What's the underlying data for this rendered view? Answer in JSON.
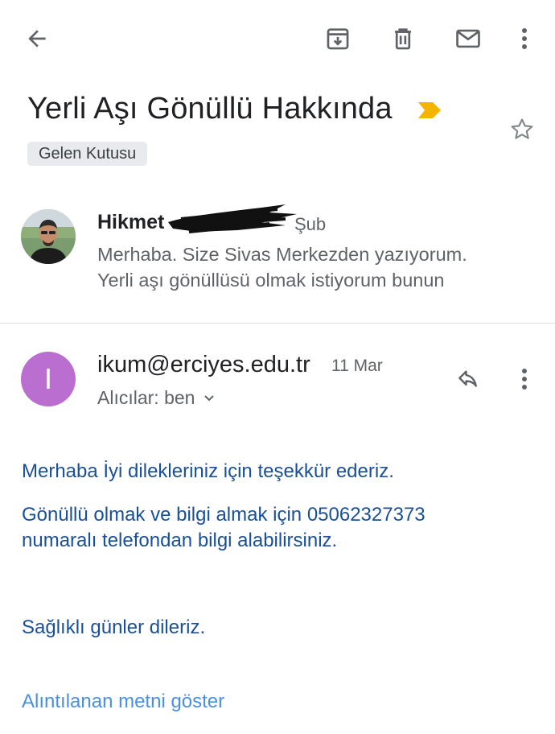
{
  "toolbar": {
    "back_icon": "arrow-back-icon",
    "archive_icon": "archive-icon",
    "delete_icon": "trash-icon",
    "mark_unread_icon": "envelope-icon",
    "more_icon": "more-vert-icon"
  },
  "subject": {
    "title": "Yerli Aşı Gönüllü Hakkında",
    "importance_color": "#f4b400",
    "star_icon": "star-outline-icon"
  },
  "label": "Gelen Kutusu",
  "thread": {
    "collapsed_message": {
      "sender": "Hikmet",
      "date": "Şub",
      "snippet_line1": "Merhaba. Size Sivas Merkezden yazıyorum.",
      "snippet_line2": "Yerli aşı gönüllüsü olmak istiyorum bunun"
    },
    "open_message": {
      "avatar_letter": "I",
      "avatar_color": "#b96ed0",
      "sender": "ikum@erciyes.edu.tr",
      "date": "11 Mar",
      "recipients": "Alıcılar: ben",
      "body_line1": "Merhaba İyi dilekleriniz için teşekkür ederiz.",
      "body_line2": "Gönüllü olmak ve bilgi almak için 05062327373",
      "body_line3": "numaralı telefondan bilgi alabilirsiniz.",
      "body_line4": "Sağlıklı günler dileriz.",
      "show_quoted": "Alıntılanan metni göster"
    }
  }
}
